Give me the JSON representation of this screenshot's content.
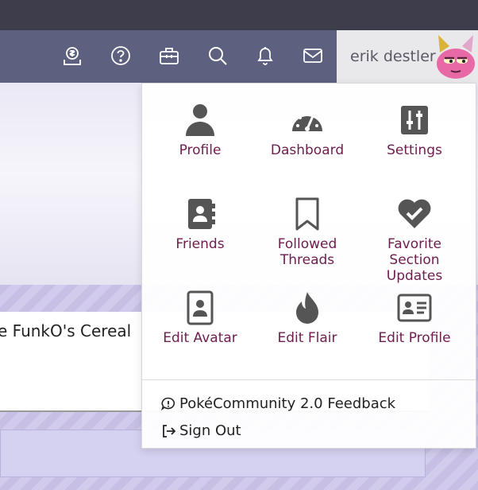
{
  "navbar": {
    "icons": [
      "currency-icon",
      "help-icon",
      "toolbox-icon",
      "search-icon",
      "bell-icon",
      "mail-icon"
    ],
    "user": {
      "name": "erik destler",
      "avatar": "pink-creature-avatar"
    }
  },
  "post": {
    "title": "e FunkO's Cereal"
  },
  "menu": {
    "items": [
      {
        "label": "Profile",
        "icon": "user-icon"
      },
      {
        "label": "Dashboard",
        "icon": "gauge-icon"
      },
      {
        "label": "Settings",
        "icon": "sliders-icon"
      },
      {
        "label": "Friends",
        "icon": "address-book-icon"
      },
      {
        "label": "Followed Threads",
        "icon": "bookmark-icon"
      },
      {
        "label": "Favorite Section Updates",
        "icon": "heart-check-icon"
      },
      {
        "label": "Edit Avatar",
        "icon": "portrait-icon"
      },
      {
        "label": "Edit Flair",
        "icon": "flame-icon"
      },
      {
        "label": "Edit Profile",
        "icon": "id-card-icon"
      }
    ],
    "feedback": "PokéCommunity 2.0 Feedback",
    "signout": "Sign Out"
  },
  "colors": {
    "navbar": "#5e6080",
    "menu_text": "#6e1d4e",
    "top_strip": "#3d3d4c"
  }
}
